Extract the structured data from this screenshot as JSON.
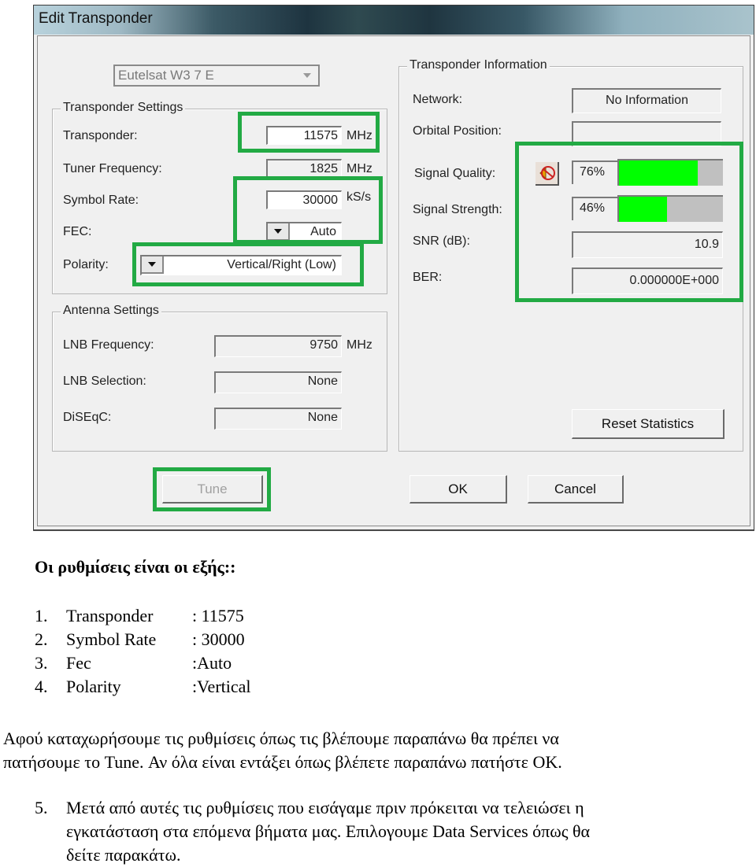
{
  "dialog": {
    "title": "Edit Transponder",
    "satellite": "Eutelsat W3 7 E",
    "transponder_settings": {
      "group_label": "Transponder Settings",
      "transponder": {
        "label": "Transponder:",
        "value": "11575",
        "unit": "MHz"
      },
      "tuner_frequency": {
        "label": "Tuner Frequency:",
        "value": "1825",
        "unit": "MHz"
      },
      "symbol_rate": {
        "label": "Symbol Rate:",
        "value": "30000",
        "unit": "kS/s"
      },
      "fec": {
        "label": "FEC:",
        "value": "Auto"
      },
      "polarity": {
        "label": "Polarity:",
        "value": "Vertical/Right (Low)"
      }
    },
    "antenna_settings": {
      "group_label": "Antenna Settings",
      "lnb_frequency": {
        "label": "LNB Frequency:",
        "value": "9750",
        "unit": "MHz"
      },
      "lnb_selection": {
        "label": "LNB Selection:",
        "value": "None"
      },
      "diseqc": {
        "label": "DiSEqC:",
        "value": "None"
      }
    },
    "transponder_information": {
      "group_label": "Transponder Information",
      "network": {
        "label": "Network:",
        "value": "No Information"
      },
      "orbital_position": {
        "label": "Orbital Position:",
        "value": ""
      },
      "signal_quality": {
        "label": "Signal Quality:",
        "value": "76%",
        "percent": 76
      },
      "signal_strength": {
        "label": "Signal Strength:",
        "value": "46%",
        "percent": 46
      },
      "snr": {
        "label": "SNR (dB):",
        "value": "10.9"
      },
      "ber": {
        "label": "BER:",
        "value": "0.000000E+000"
      },
      "reset_label": "Reset Statistics"
    },
    "buttons": {
      "tune": "Tune",
      "ok": "OK",
      "cancel": "Cancel"
    },
    "colors": {
      "highlight": "#22aa44",
      "bar_fill": "#00ff00",
      "bar_empty": "#c0c0c0"
    }
  },
  "document": {
    "heading": "Οι ρυθμίσεις είναι οι εξής::",
    "settings_list": [
      {
        "num": "1.",
        "key": "Transponder",
        "value": ": 11575"
      },
      {
        "num": "2.",
        "key": "Symbol Rate",
        "value": ": 30000"
      },
      {
        "num": "3.",
        "key": "Fec",
        "value": ":Auto"
      },
      {
        "num": "4.",
        "key": "Polarity",
        "value": ":Vertical"
      }
    ],
    "paragraph_line1": "Αφού καταχωρήσουμε τις ρυθμίσεις όπως τις βλέπουμε παραπάνω θα πρέπει να",
    "paragraph_line2": "πατήσουμε το Tune. Αν όλα είναι εντάξει όπως βλέπετε παραπάνω πατήστε OK.",
    "step5": {
      "num": "5.",
      "line1": "Μετά από αυτές τις ρυθμίσεις που εισάγαμε πριν πρόκειται να τελειώσει η",
      "line2": "εγκατάσταση στα επόμενα βήματα μας. Επιλογουμε Data Services όπως θα",
      "line3": "δείτε παρακάτω."
    }
  }
}
